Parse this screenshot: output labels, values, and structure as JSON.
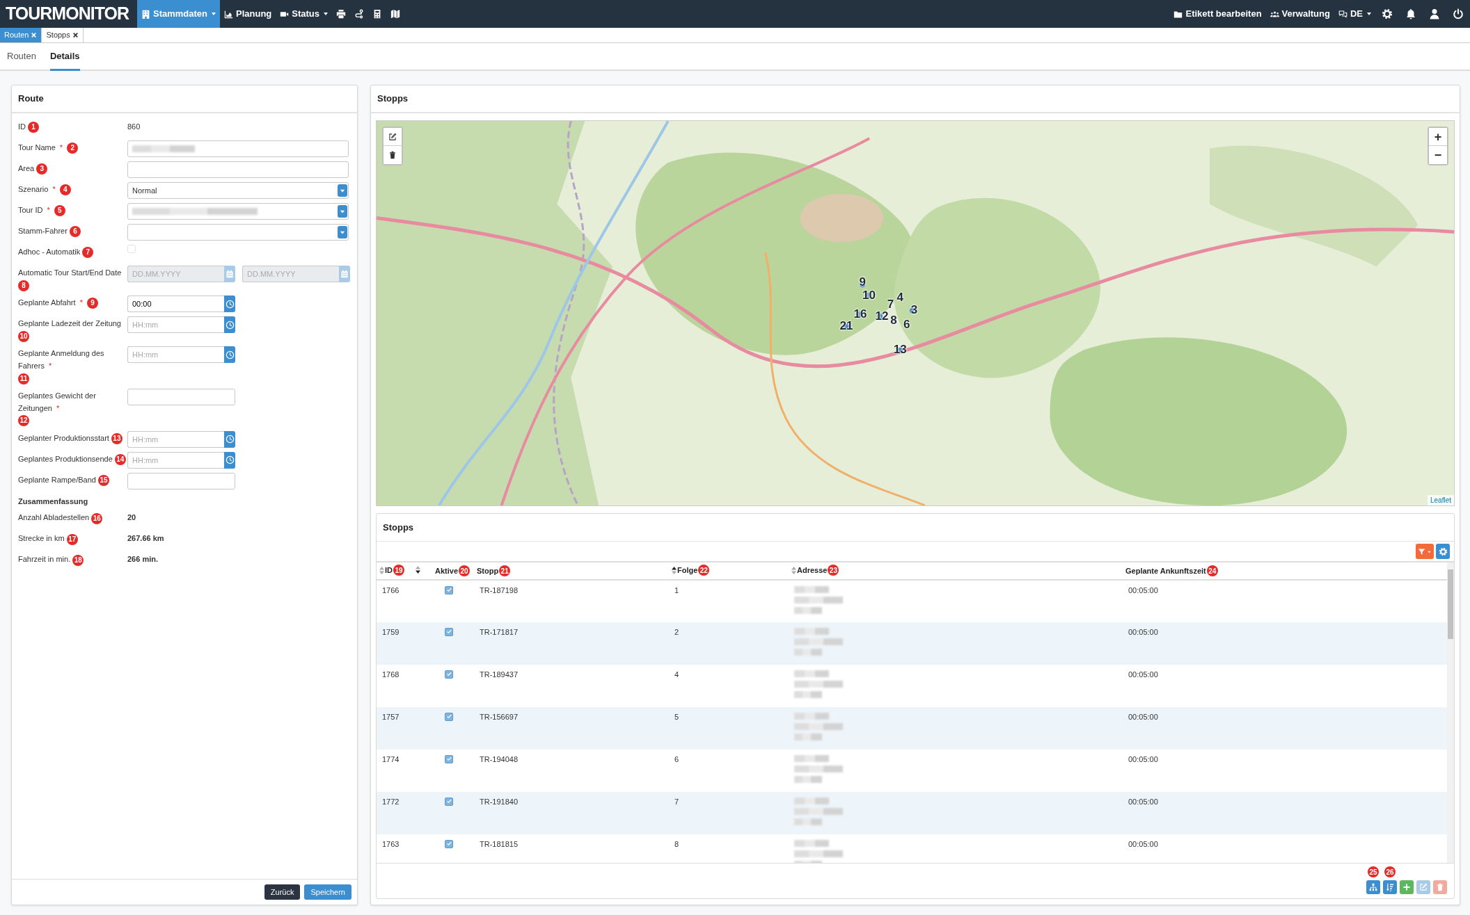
{
  "navbar": {
    "brand": "TOURMONITOR",
    "items": [
      {
        "label": "Stammdaten",
        "kind": "dropdown",
        "selected": true
      },
      {
        "label": "Planung",
        "kind": "link",
        "selected": false
      },
      {
        "label": "Status",
        "kind": "dropdown",
        "selected": false
      }
    ],
    "right_items": [
      {
        "label": "Etikett bearbeiten",
        "kind": "link"
      },
      {
        "label": "Verwaltung",
        "kind": "link"
      },
      {
        "label": "DE",
        "kind": "dropdown"
      }
    ]
  },
  "doc_tabs": [
    {
      "label": "Routen",
      "selected": true
    },
    {
      "label": "Stopps",
      "selected": false
    }
  ],
  "sub_tabs": [
    {
      "label": "Routen",
      "selected": false
    },
    {
      "label": "Details",
      "selected": true
    }
  ],
  "route_panel": {
    "title": "Route",
    "fields": [
      {
        "kind": "static",
        "label": "ID",
        "badge": "1",
        "value": "860"
      },
      {
        "kind": "text",
        "label": "Tour Name",
        "required_mark": "*",
        "badge": "2",
        "redacted": true
      },
      {
        "kind": "text",
        "label": "Area",
        "badge": "3"
      },
      {
        "kind": "select",
        "label": "Szenario",
        "required_mark": "*",
        "badge": "4",
        "value": "Normal"
      },
      {
        "kind": "select",
        "label": "Tour ID",
        "required_mark": "*",
        "badge": "5",
        "redacted": true
      },
      {
        "kind": "select",
        "label": "Stamm-Fahrer",
        "badge": "6"
      },
      {
        "kind": "checkbox",
        "label": "Adhoc - Automatik",
        "badge": "7",
        "checked": false
      },
      {
        "kind": "daterange",
        "label": "Automatic Tour Start/End Date",
        "badge": "8",
        "placeholders": [
          "DD.MM.YYYY",
          "DD.MM.YYYY"
        ],
        "disabled": true
      },
      {
        "kind": "time",
        "label": "Geplante Abfahrt",
        "required_mark": "*",
        "badge": "9",
        "value": "00:00"
      },
      {
        "kind": "time",
        "label": "Geplante Ladezeit der Zeitung",
        "badge": "10",
        "placeholder": "HH:mm"
      },
      {
        "kind": "time",
        "label": "Geplante Anmeldung des Fahrers",
        "required_mark": "*",
        "badge": "11",
        "placeholder": "HH:mm"
      },
      {
        "kind": "short_text",
        "label": "Geplantes Gewicht der Zeitungen",
        "required_mark": "*",
        "badge": "12"
      },
      {
        "kind": "time",
        "label": "Geplanter Produktionsstart",
        "badge": "13",
        "placeholder": "HH:mm"
      },
      {
        "kind": "time",
        "label": "Geplantes Produktionsende",
        "badge": "14",
        "placeholder": "HH:mm"
      },
      {
        "kind": "short_text",
        "label": "Geplante Rampe/Band",
        "badge": "15"
      },
      {
        "kind": "heading",
        "label": "Zusammenfassung"
      },
      {
        "kind": "summary",
        "label": "Anzahl Abladestellen",
        "badge": "16",
        "value": "20"
      },
      {
        "kind": "summary",
        "label": "Strecke in km",
        "badge": "17",
        "value": "267.66 km"
      },
      {
        "kind": "summary",
        "label": "Fahrzeit in min.",
        "badge": "18",
        "value": "266 min."
      }
    ],
    "buttons": [
      {
        "label": "Zurück",
        "kind": "secondary"
      },
      {
        "label": "Speichern",
        "kind": "primary"
      }
    ]
  },
  "stops_panel": {
    "title": "Stopps",
    "map": {
      "markers": [
        "9",
        "10",
        "16",
        "12",
        "21",
        "7",
        "4",
        "8",
        "6",
        "3",
        "13"
      ],
      "zoom_controls": [
        "+",
        "−"
      ],
      "attribution": "Leaflet"
    },
    "table_title": "Stopps",
    "columns": [
      {
        "label": "ID",
        "badge": "19",
        "sorted_asc": false,
        "sorted_desc": false
      },
      {
        "sorted_asc": false,
        "sorted_desc": true
      },
      {
        "label": "Aktive",
        "badge": "20"
      },
      {
        "label": "Stopp",
        "badge": "21"
      },
      {
        "label": "Folge",
        "badge": "22",
        "sorted_asc": true,
        "sorted_desc": false
      },
      {
        "label": "Adresse",
        "badge": "23",
        "sorted_asc": false,
        "sorted_desc": false
      },
      {
        "label": "Geplante Ankunftszeit",
        "badge": "24"
      }
    ],
    "rows": [
      {
        "id": "1766",
        "active": true,
        "stop": "TR-187198",
        "sequence": "1",
        "arrival": "00:05:00"
      },
      {
        "id": "1759",
        "active": true,
        "stop": "TR-171817",
        "sequence": "2",
        "arrival": "00:05:00"
      },
      {
        "id": "1768",
        "active": true,
        "stop": "TR-189437",
        "sequence": "4",
        "arrival": "00:05:00"
      },
      {
        "id": "1757",
        "active": true,
        "stop": "TR-156697",
        "sequence": "5",
        "arrival": "00:05:00"
      },
      {
        "id": "1774",
        "active": true,
        "stop": "TR-194048",
        "sequence": "6",
        "arrival": "00:05:00"
      },
      {
        "id": "1772",
        "active": true,
        "stop": "TR-191840",
        "sequence": "7",
        "arrival": "00:05:00"
      },
      {
        "id": "1763",
        "active": true,
        "stop": "TR-181815",
        "sequence": "8",
        "arrival": "00:05:00"
      }
    ],
    "footer_badges": [
      "25",
      "26"
    ]
  }
}
